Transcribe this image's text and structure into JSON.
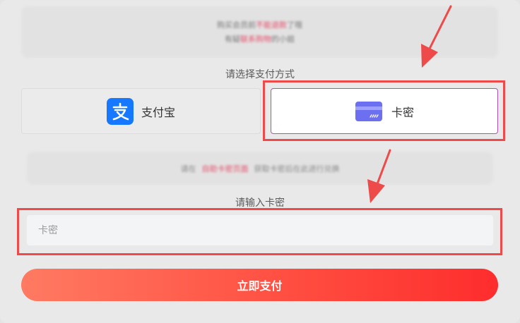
{
  "notice": {
    "line1_a": "购买会员前",
    "line1_red": "不能退款",
    "line1_b": "了哦",
    "line2_a": "有疑",
    "line2_red": "联系购物",
    "line2_b": "的小姐"
  },
  "payment": {
    "section_label": "请选择支付方式",
    "options": [
      {
        "label": "支付宝",
        "icon": "alipay-icon"
      },
      {
        "label": "卡密",
        "icon": "credit-card-icon"
      }
    ],
    "selected": "卡密"
  },
  "hint": {
    "text_a": "请在",
    "text_red": "自助卡密页面",
    "text_b": "获取卡密后在此进行兑换"
  },
  "card_input": {
    "label": "请输入卡密",
    "placeholder": "卡密",
    "value": ""
  },
  "submit": {
    "label": "立即支付"
  },
  "colors": {
    "annotation_red": "#ee4a4a",
    "selected_border": "#b04fb4",
    "alipay_blue": "#1677ff",
    "button_gradient_start": "#ff7a62",
    "button_gradient_end": "#fe2d2d"
  }
}
